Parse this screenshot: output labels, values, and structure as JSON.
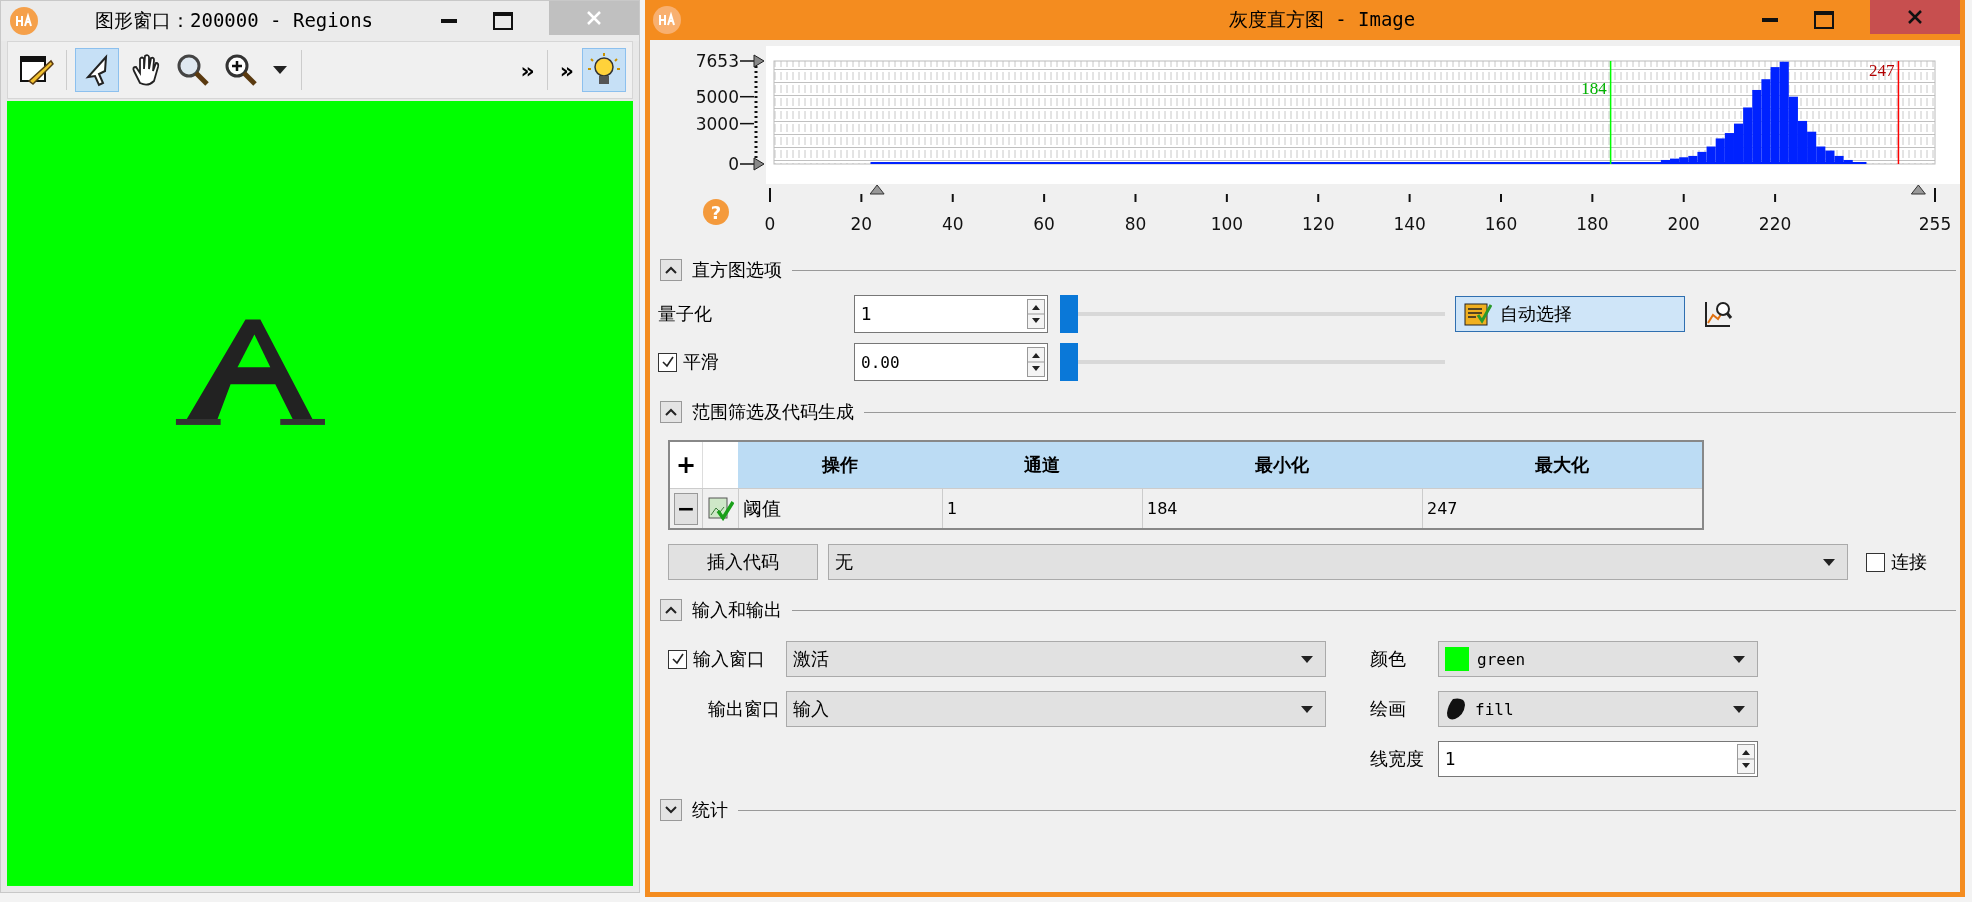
{
  "graphics_window": {
    "title": "图形窗口：200000 - Regions",
    "toolbar": [
      {
        "kind": "edit",
        "selected": false
      },
      {
        "kind": "pointer",
        "selected": true
      },
      {
        "kind": "hand",
        "selected": false
      },
      {
        "kind": "zoom",
        "selected": false
      },
      {
        "kind": "zoom-in",
        "selected": false
      }
    ],
    "overflow": [
      "»",
      "»"
    ],
    "light_selected": true
  },
  "histogram_window": {
    "title": "灰度直方图 - Image",
    "help_glyph": "?",
    "chart_data": {
      "type": "bar",
      "x": [
        196,
        198,
        200,
        202,
        204,
        206,
        208,
        210,
        212,
        214,
        216,
        218,
        220,
        222,
        224,
        226,
        228,
        230,
        232,
        234,
        236
      ],
      "values": [
        300,
        400,
        500,
        600,
        900,
        1300,
        1900,
        2300,
        3000,
        4200,
        5500,
        6300,
        7200,
        7600,
        5000,
        3200,
        2400,
        1300,
        1000,
        600,
        300
      ],
      "xlim": [
        0,
        255
      ],
      "ylim": [
        0,
        7653
      ],
      "xticks": [
        0,
        20,
        40,
        60,
        80,
        100,
        120,
        140,
        160,
        180,
        200,
        220,
        255
      ],
      "yticks": [
        0,
        3000,
        5000,
        7653
      ],
      "ref_lines": [
        {
          "axis": "x",
          "value": 184,
          "label": "184",
          "color": "#00ff00"
        },
        {
          "axis": "x",
          "value": 247,
          "label": "247",
          "color": "#ff0000"
        }
      ]
    },
    "handles": [
      {
        "level": 0.09
      },
      {
        "level": 0.965
      }
    ]
  },
  "histogram_options": {
    "title": "直方图选项",
    "expanded": true,
    "quantize": {
      "label": "量子化",
      "value": "1",
      "level": 0
    },
    "smooth": {
      "label": "平滑",
      "checked": true,
      "value": "0.00",
      "level": 0
    },
    "auto_button": "自动选择"
  },
  "range_filter": {
    "title": "范围筛选及代码生成",
    "expanded": true,
    "add_button": "+",
    "columns": [
      "操作",
      "通道",
      "最小化",
      "最大化"
    ],
    "rows": [
      {
        "remove_button": "−",
        "cells": [
          "阈值",
          "1",
          "184",
          "247"
        ]
      }
    ],
    "insert_button": "插入代码",
    "insert_select": "无",
    "connect": {
      "label": "连接",
      "checked": false
    }
  },
  "io": {
    "title": "输入和输出",
    "expanded": true,
    "input_window": {
      "label": "输入窗口",
      "checked": true,
      "value": "激活"
    },
    "output_window": {
      "label": "输出窗口",
      "value": "输入"
    },
    "color": {
      "label": "颜色",
      "value": "green",
      "color": "#00ff00"
    },
    "draw": {
      "label": "绘画",
      "value": "fill"
    },
    "line_width": {
      "label": "线宽度",
      "value": "1"
    }
  },
  "statistics": {
    "title": "统计",
    "expanded": false
  }
}
